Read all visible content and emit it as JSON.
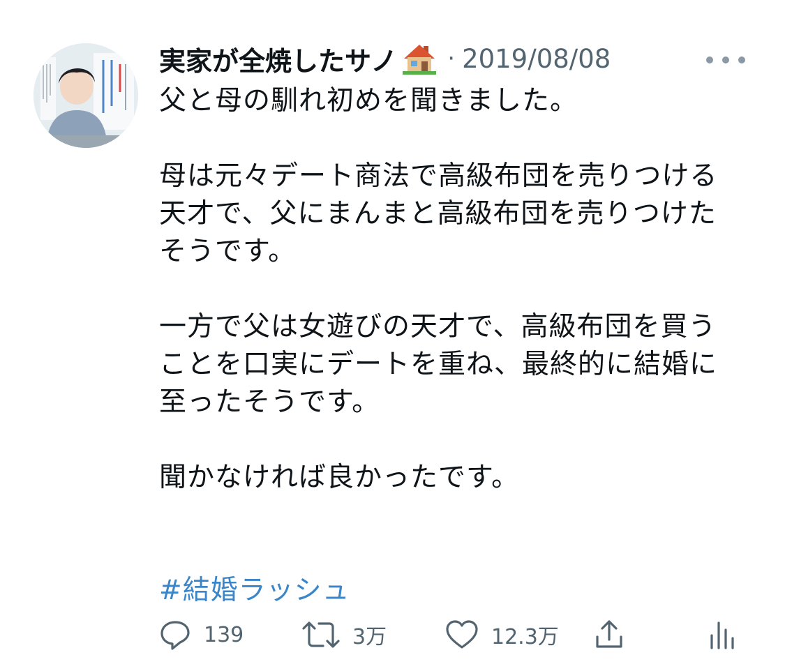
{
  "user": {
    "display_name": "実家が全焼したサノ",
    "name_emoji": "house-with-garden-icon",
    "separator": "·",
    "date": "2019/08/08"
  },
  "tweet": {
    "paragraphs": [
      [
        "父と母の馴れ初めを聞きました。"
      ],
      [
        "母は元々デート商法で高級布団を売りつける",
        "天才で、父にまんまと高級布団を売りつけた",
        "そうです。"
      ],
      [
        "一方で父は女遊びの天才で、高級布団を買う",
        "ことを口実にデートを重ね、最終的に結婚に",
        "至ったそうです。"
      ],
      [
        "聞かなければ良かったです。"
      ]
    ],
    "hashtag": "#結婚ラッシュ"
  },
  "actions": {
    "reply": {
      "icon": "reply-icon",
      "count": "139"
    },
    "retweet": {
      "icon": "retweet-icon",
      "count": "3万"
    },
    "like": {
      "icon": "heart-icon",
      "count": "12.3万"
    },
    "share": {
      "icon": "share-icon"
    },
    "analytics": {
      "icon": "analytics-icon"
    }
  },
  "colors": {
    "text": "#0f1419",
    "secondary": "#536471",
    "link": "#3a86c8"
  }
}
